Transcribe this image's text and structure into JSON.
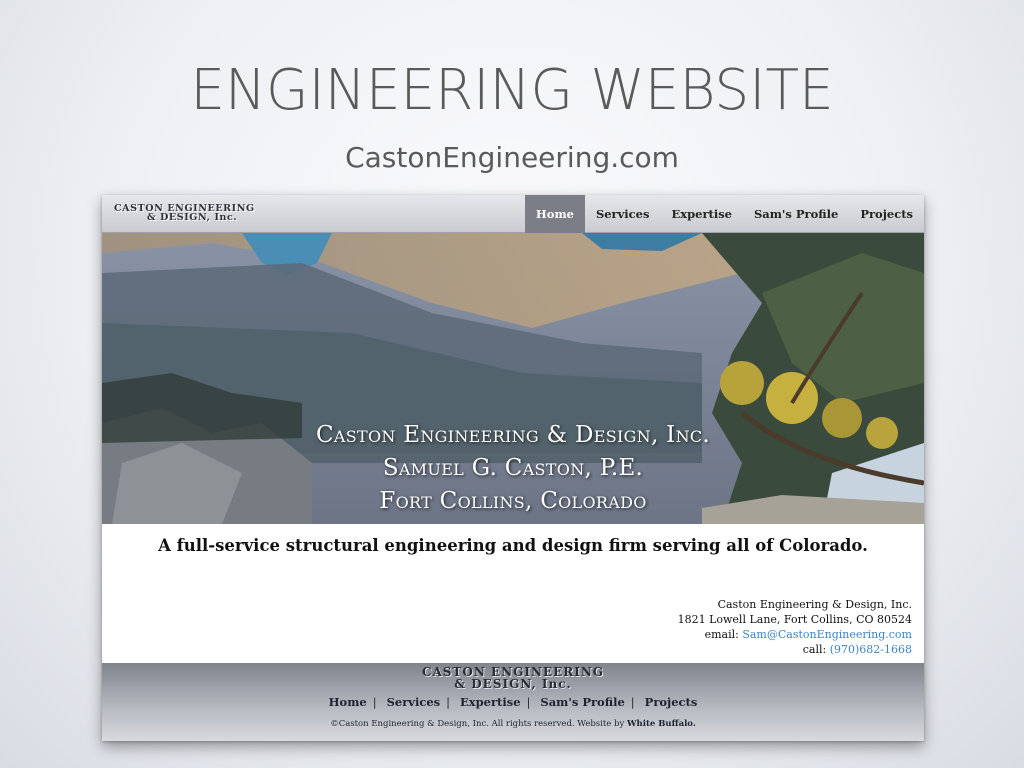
{
  "slide": {
    "title": "ENGINEERING WEBSITE",
    "subtitle": "CastonEngineering.com"
  },
  "site": {
    "logo_line1": "CASTON ENGINEERING",
    "logo_line2": "& DESIGN, Inc.",
    "nav": [
      {
        "label": "Home",
        "active": true
      },
      {
        "label": "Services",
        "active": false
      },
      {
        "label": "Expertise",
        "active": false
      },
      {
        "label": "Sam's Profile",
        "active": false
      },
      {
        "label": "Projects",
        "active": false
      }
    ],
    "hero": {
      "line1": "Caston Engineering & Design, Inc.",
      "line2": "Samuel G. Caston, P.E.",
      "line3": "Fort Collins, Colorado"
    },
    "tagline": "A full-service structural engineering and design firm serving all of Colorado.",
    "contact": {
      "company": "Caston Engineering & Design, Inc.",
      "address": "1821 Lowell Lane, Fort Collins, CO 80524",
      "email_label": "email:",
      "email": "Sam@CastonEngineering.com",
      "call_label": "call:",
      "phone": "(970)682-1668"
    },
    "footer": {
      "logo_line1": "CASTON ENGINEERING",
      "logo_line2": "& DESIGN, Inc.",
      "nav": [
        "Home",
        "Services",
        "Expertise",
        "Sam's Profile",
        "Projects"
      ],
      "copyright": "©Caston Engineering & Design, Inc. All rights reserved. Website by",
      "credit": "White Buffalo."
    },
    "colors": {
      "link": "#3c83c5",
      "nav_active_bg": "#7b7e86"
    }
  }
}
